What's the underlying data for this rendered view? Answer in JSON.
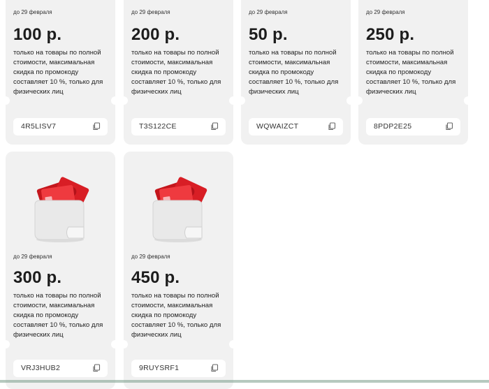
{
  "coupons": [
    {
      "date": "до 29 февраля",
      "amount": "100 р.",
      "desc": "только на товары по полной стоимости, максимальная скидка по промокоду составляет 10 %, только для физических лиц",
      "code": "4R5LISV7"
    },
    {
      "date": "до 29 февраля",
      "amount": "200 р.",
      "desc": "только на товары по полной стоимости, максимальная скидка по промокоду составляет 10 %, только для физических лиц",
      "code": "T3S122CE"
    },
    {
      "date": "до 29 февраля",
      "amount": "50 р.",
      "desc": "только на товары по полной стоимости, максимальная скидка по промокоду составляет 10 %, только для физических лиц",
      "code": "WQWAIZCT"
    },
    {
      "date": "до 29 февраля",
      "amount": "250 р.",
      "desc": "только на товары по полной стоимости, максимальная скидка по промокоду составляет 10 %, только для физических лиц",
      "code": "8PDP2E25"
    },
    {
      "date": "до 29 февраля",
      "amount": "300 р.",
      "desc": "только на товары по полной стоимости, максимальная скидка по промокоду составляет 10 %, только для физических лиц",
      "code": "VRJ3HUB2"
    },
    {
      "date": "до 29 февраля",
      "amount": "450 р.",
      "desc": "только на товары по полной стоимости, максимальная скидка по промокоду составляет 10 %, только для физических лиц",
      "code": "9RUYSRF1"
    }
  ],
  "icons": {
    "copy": "copy-icon",
    "wallet": "wallet-illustration"
  },
  "colors": {
    "card_bg": "#f1f1f1",
    "accent_red": "#e8232a"
  }
}
